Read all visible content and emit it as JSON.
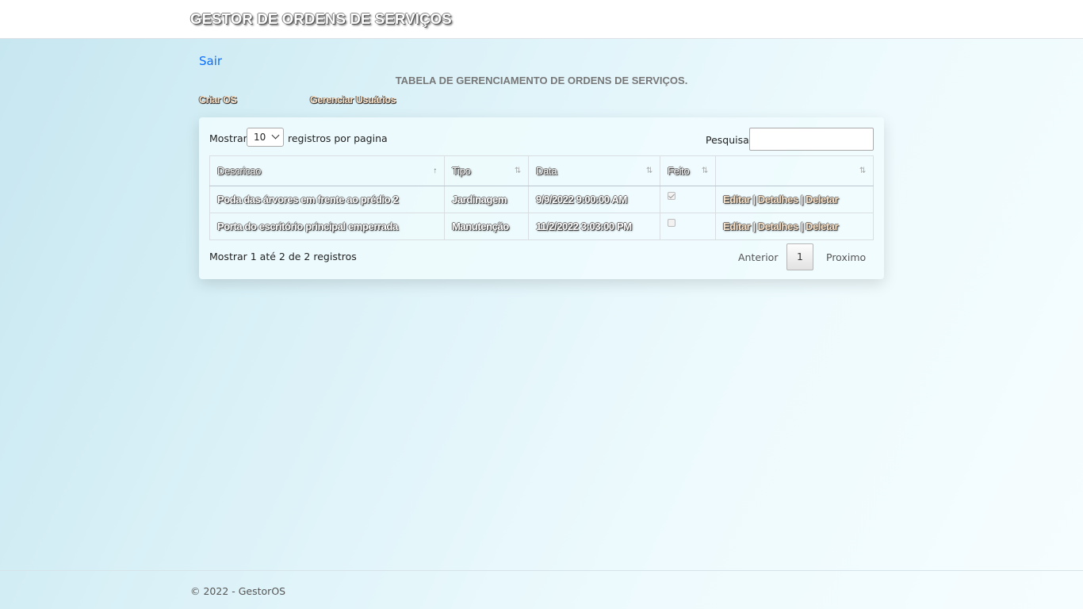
{
  "header": {
    "brand": "GESTOR DE ORDENS DE SERVIÇOS"
  },
  "nav": {
    "logout": "Sair",
    "create_os": "Criar OS",
    "manage_users": "Gerenciar Usuários"
  },
  "page": {
    "title": "TABELA DE GERENCIAMENTO DE ORDENS DE SERVIÇOS."
  },
  "table_controls": {
    "show_prefix": "Mostrar",
    "page_size": "10",
    "show_suffix": "registros por pagina",
    "search_label": "Pesquisar",
    "search_value": ""
  },
  "table": {
    "columns": [
      "Descricao",
      "Tipo",
      "Data",
      "Feito",
      ""
    ],
    "rows": [
      {
        "descricao": "Poda das árvores em frente ao prédio 2",
        "tipo": "Jardinagem",
        "data": "9/9/2022 9:00:00 AM",
        "feito": true
      },
      {
        "descricao": "Porta do escritório principal emperrada",
        "tipo": "Manutenção",
        "data": "11/2/2022 3:03:00 PM",
        "feito": false
      }
    ],
    "actions": {
      "edit": "Editar",
      "details": "Detalhes",
      "delete": "Deletar",
      "separator": "|"
    }
  },
  "pagination": {
    "info": "Mostrar 1 até 2 de 2 registros",
    "previous": "Anterior",
    "current": "1",
    "next": "Proximo"
  },
  "footer": {
    "text": "© 2022 - GestorOS"
  },
  "icons": {
    "sort_asc": "sort-asc-icon",
    "sort_both": "sort-both-icon",
    "select_chevron": "chevron-down-icon"
  }
}
